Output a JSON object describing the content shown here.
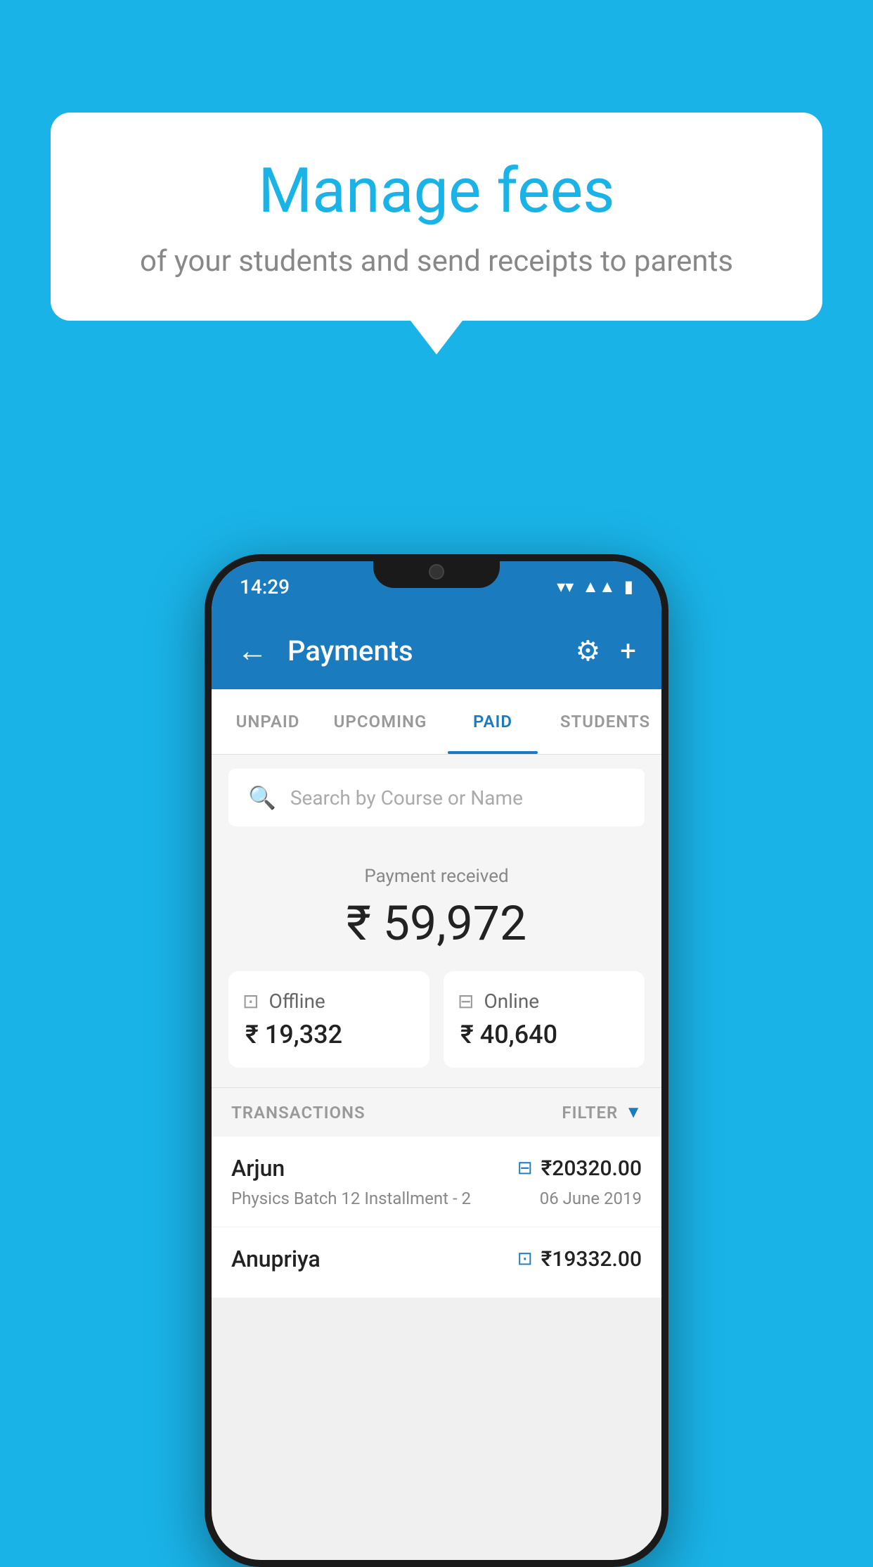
{
  "page": {
    "background_color": "#1ab3e8"
  },
  "speech_bubble": {
    "title": "Manage fees",
    "subtitle": "of your students and send receipts to parents"
  },
  "status_bar": {
    "time": "14:29",
    "wifi": "▼",
    "signal": "▲",
    "battery": "▪"
  },
  "header": {
    "title": "Payments",
    "back_label": "←",
    "gear_label": "⚙",
    "plus_label": "+"
  },
  "tabs": [
    {
      "label": "UNPAID",
      "active": false
    },
    {
      "label": "UPCOMING",
      "active": false
    },
    {
      "label": "PAID",
      "active": true
    },
    {
      "label": "STUDENTS",
      "active": false
    }
  ],
  "search": {
    "placeholder": "Search by Course or Name"
  },
  "payment_summary": {
    "label": "Payment received",
    "amount": "₹ 59,972",
    "offline": {
      "label": "Offline",
      "amount": "₹ 19,332"
    },
    "online": {
      "label": "Online",
      "amount": "₹ 40,640"
    }
  },
  "transactions": {
    "header_label": "TRANSACTIONS",
    "filter_label": "FILTER",
    "items": [
      {
        "name": "Arjun",
        "amount": "₹20320.00",
        "detail": "Physics Batch 12 Installment - 2",
        "date": "06 June 2019",
        "payment_type": "online"
      },
      {
        "name": "Anupriya",
        "amount": "₹19332.00",
        "detail": "",
        "date": "",
        "payment_type": "offline"
      }
    ]
  }
}
